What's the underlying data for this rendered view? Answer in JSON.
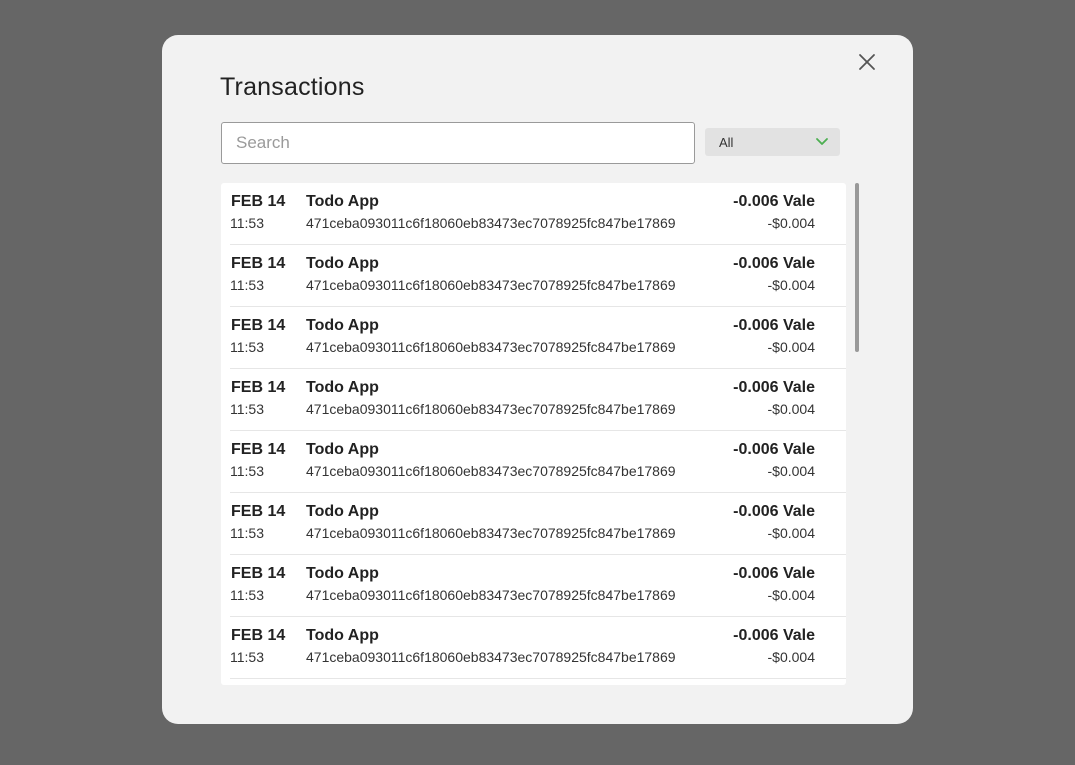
{
  "modal": {
    "title": "Transactions"
  },
  "search": {
    "placeholder": "Search",
    "value": ""
  },
  "filter": {
    "selected": "All"
  },
  "colors": {
    "accent": "#4caf50",
    "backdrop": "#666666",
    "modal_bg": "#f2f2f2"
  },
  "icons": {
    "close": "close-icon",
    "dropdown": "chevron-down-icon"
  },
  "transactions": [
    {
      "date": "FEB 14",
      "time": "11:53",
      "name": "Todo App",
      "hash": "471ceba093011c6f18060eb83473ec7078925fc847be17869",
      "amount": "-0.006 Vale",
      "fiat": "-$0.004"
    },
    {
      "date": "FEB 14",
      "time": "11:53",
      "name": "Todo App",
      "hash": "471ceba093011c6f18060eb83473ec7078925fc847be17869",
      "amount": "-0.006 Vale",
      "fiat": "-$0.004"
    },
    {
      "date": "FEB 14",
      "time": "11:53",
      "name": "Todo App",
      "hash": "471ceba093011c6f18060eb83473ec7078925fc847be17869",
      "amount": "-0.006 Vale",
      "fiat": "-$0.004"
    },
    {
      "date": "FEB 14",
      "time": "11:53",
      "name": "Todo App",
      "hash": "471ceba093011c6f18060eb83473ec7078925fc847be17869",
      "amount": "-0.006 Vale",
      "fiat": "-$0.004"
    },
    {
      "date": "FEB 14",
      "time": "11:53",
      "name": "Todo App",
      "hash": "471ceba093011c6f18060eb83473ec7078925fc847be17869",
      "amount": "-0.006 Vale",
      "fiat": "-$0.004"
    },
    {
      "date": "FEB 14",
      "time": "11:53",
      "name": "Todo App",
      "hash": "471ceba093011c6f18060eb83473ec7078925fc847be17869",
      "amount": "-0.006 Vale",
      "fiat": "-$0.004"
    },
    {
      "date": "FEB 14",
      "time": "11:53",
      "name": "Todo App",
      "hash": "471ceba093011c6f18060eb83473ec7078925fc847be17869",
      "amount": "-0.006 Vale",
      "fiat": "-$0.004"
    },
    {
      "date": "FEB 14",
      "time": "11:53",
      "name": "Todo App",
      "hash": "471ceba093011c6f18060eb83473ec7078925fc847be17869",
      "amount": "-0.006 Vale",
      "fiat": "-$0.004"
    }
  ]
}
